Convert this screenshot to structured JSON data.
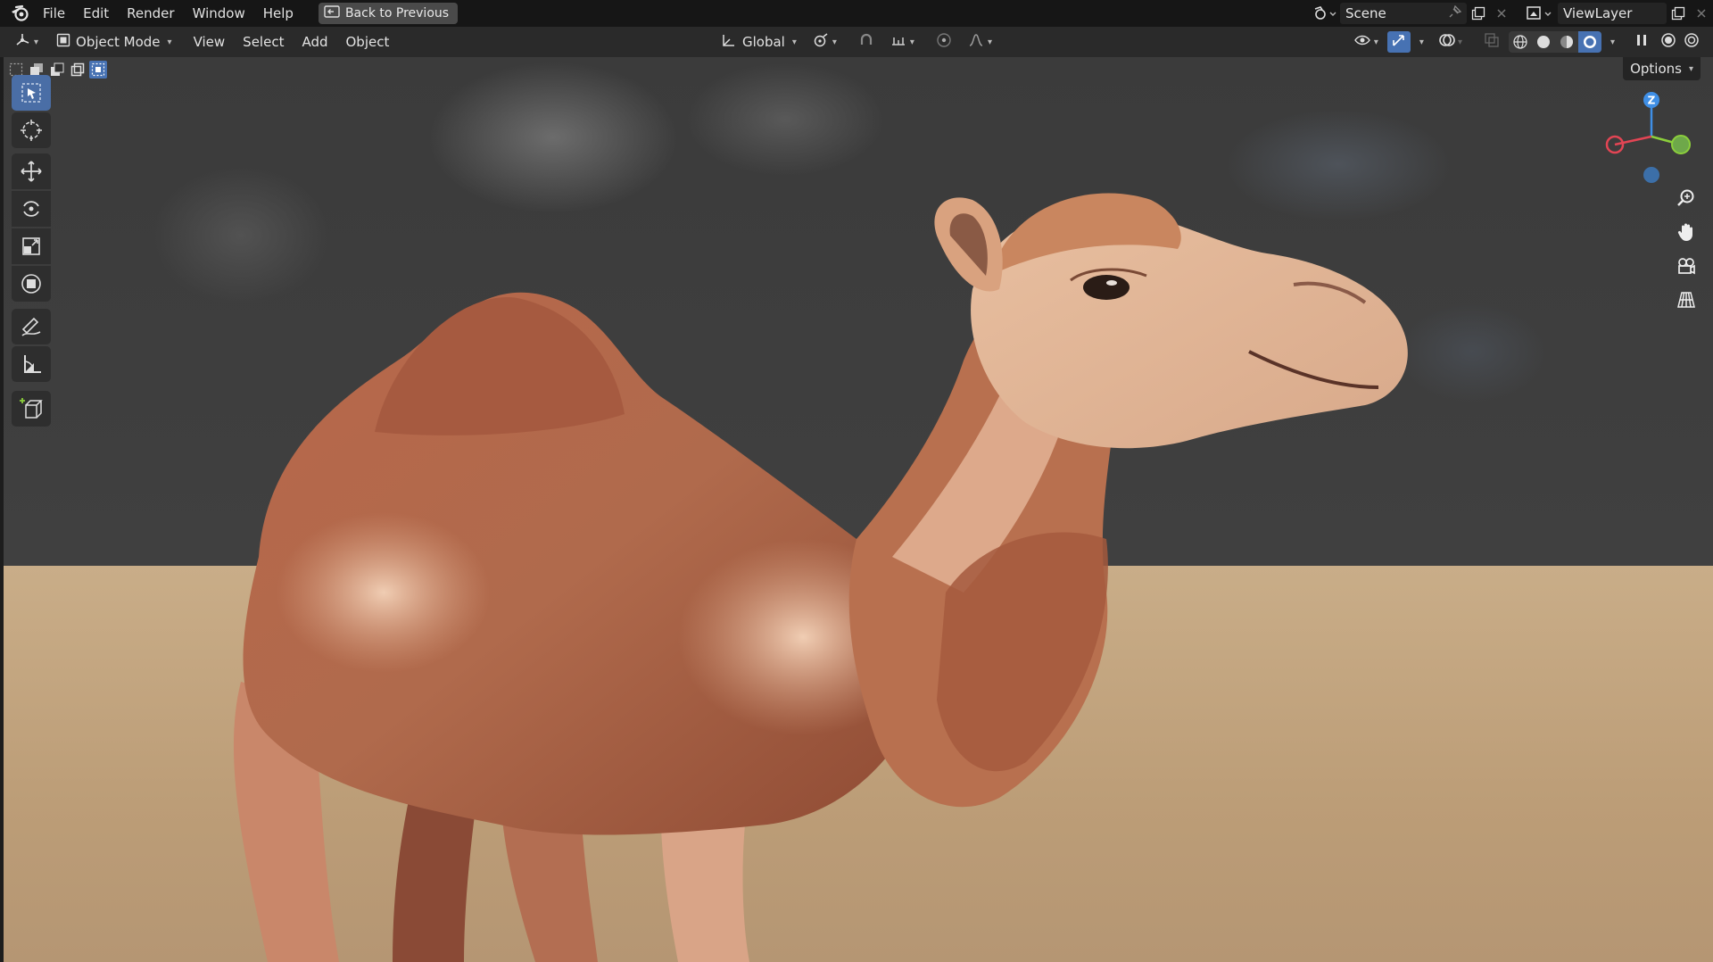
{
  "topbar": {
    "menus": [
      "File",
      "Edit",
      "Render",
      "Window",
      "Help"
    ],
    "back_button": "Back to Previous",
    "scene_name": "Scene",
    "view_layer": "ViewLayer"
  },
  "header": {
    "mode": "Object Mode",
    "menus": [
      "View",
      "Select",
      "Add",
      "Object"
    ],
    "transform_orientation": "Global",
    "options_label": "Options"
  },
  "toolbar": {
    "tools": [
      "select-box-tool",
      "cursor-tool",
      "move-tool",
      "rotate-tool",
      "scale-tool",
      "transform-tool",
      "annotate-tool",
      "measure-tool",
      "add-cube-tool"
    ],
    "active_tool": "select-box-tool"
  },
  "gizmo": {
    "axis_labels": [
      "Z"
    ],
    "colors": {
      "x": "#e34554",
      "y": "#8ccf3c",
      "z": "#3f8fe6",
      "neg": "#3c6fa8"
    }
  },
  "colors": {
    "accent": "#4772b3",
    "topbar_bg": "#161616",
    "header_bg": "#2a2a2a",
    "ground": "#c2a37e",
    "sky": "#3c3c3c"
  }
}
